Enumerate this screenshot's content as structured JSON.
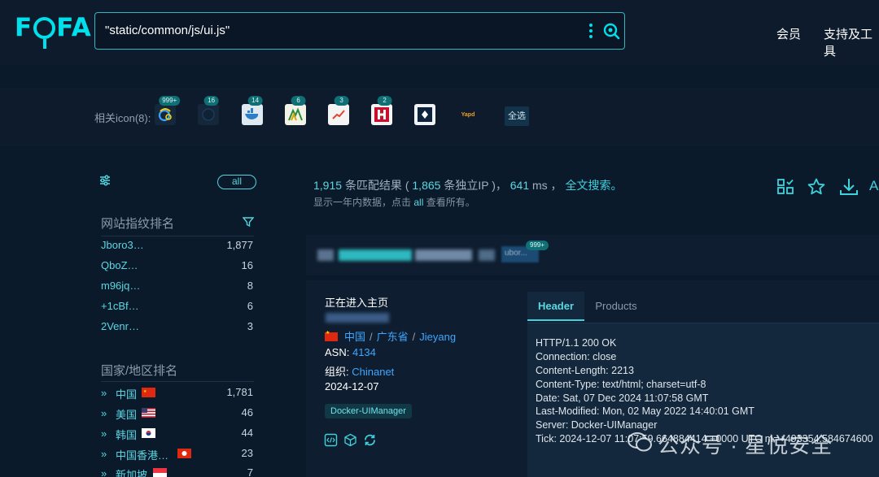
{
  "header": {
    "logo": "FOFA",
    "search_query": "\"static/common/js/ui.js\"",
    "nav": [
      "会员",
      "支持及工具"
    ]
  },
  "related_icons": {
    "label": "相关icon(8):",
    "items": [
      {
        "name": "swirl-logo-icon",
        "badge": "999+"
      },
      {
        "name": "dark-globe-icon",
        "badge": "16"
      },
      {
        "name": "docker-whale-icon",
        "badge": "14"
      },
      {
        "name": "terrain-logo-icon",
        "badge": "6"
      },
      {
        "name": "chart-logo-icon",
        "badge": "3"
      },
      {
        "name": "h-logo-icon",
        "badge": "2"
      },
      {
        "name": "diamond-logo-icon",
        "badge": ""
      },
      {
        "name": "yapd-logo-icon",
        "badge": ""
      }
    ],
    "yapd_text": "Yapd",
    "select_all": "全选"
  },
  "sidebar": {
    "all_pill": "all",
    "fingerprint_title": "网站指纹排名",
    "fingerprints": [
      {
        "name": "Jboro3…",
        "count": "1,877"
      },
      {
        "name": "QboZ…",
        "count": "16"
      },
      {
        "name": "m96jq…",
        "count": "8"
      },
      {
        "name": "+1cBf…",
        "count": "6"
      },
      {
        "name": "2Venr…",
        "count": "3"
      }
    ],
    "country_title": "国家/地区排名",
    "countries": [
      {
        "name": "中国",
        "count": "1,781",
        "flag": "cn"
      },
      {
        "name": "美国",
        "count": "46",
        "flag": "us"
      },
      {
        "name": "韩国",
        "count": "44",
        "flag": "kr"
      },
      {
        "name": "中国香港…",
        "count": "23",
        "flag": "hk"
      },
      {
        "name": "新加坡",
        "count": "7",
        "flag": "sg"
      }
    ]
  },
  "results": {
    "count": "1,915",
    "count_label": "条匹配结果 (",
    "unique_ip": "1,865",
    "unique_ip_label": "条独立IP )，",
    "ms": "641",
    "ms_label": "ms ，",
    "fulltext": "全文搜索。",
    "sub_before": "显示一年内数据，点击",
    "sub_all": "all",
    "sub_after": "查看所有。",
    "tool_letter": "A"
  },
  "card": {
    "tag_badge": "999+",
    "tag_text": "ubor...",
    "title": "正在进入主页",
    "country": "中国",
    "province": "广东省",
    "city": "Jieyang",
    "asn_label": "ASN:",
    "asn": "4134",
    "org_label": "组织:",
    "org": "Chinanet",
    "date": "2024-12-07",
    "product_tag": "Docker-UIManager"
  },
  "tabs": [
    "Header",
    "Products"
  ],
  "http_header": [
    "HTTP/1.1 200 OK",
    "Connection: close",
    "Content-Length: 2213",
    "Content-Type: text/html; charset=utf-8",
    "Date: Sat, 07 Dec 2024 11:07:58 GMT",
    "Last-Modified: Mon, 02 May 2022 14:40:01 GMT",
    "Server: Docker-UIManager",
    "Tick: 2024-12-07 11:07:59.664884414 +0000 UTC m=+493354.584674600"
  ],
  "watermark": "公众号 · 星悦安全",
  "colors": {
    "accent": "#00e0ea",
    "link": "#3fa7ff",
    "bg": "#0b1a2b",
    "panel": "#0e1d2f"
  }
}
